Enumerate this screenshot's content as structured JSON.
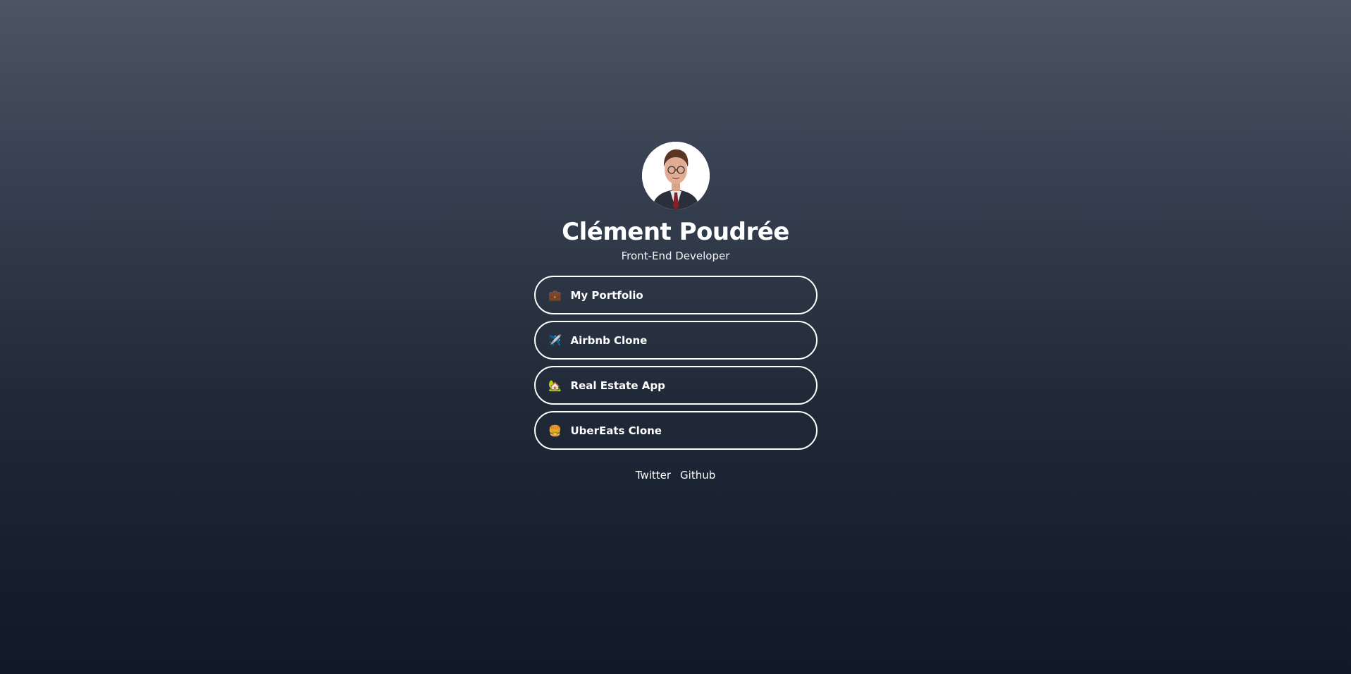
{
  "profile": {
    "name": "Clément Poudrée",
    "role": "Front-End Developer",
    "avatar_alt": "profile-photo"
  },
  "links": [
    {
      "icon": "briefcase-icon",
      "emoji": "💼",
      "label": "My Portfolio"
    },
    {
      "icon": "airplane-icon",
      "emoji": "✈️",
      "label": "Airbnb Clone"
    },
    {
      "icon": "house-icon",
      "emoji": "🏡",
      "label": "Real Estate App"
    },
    {
      "icon": "burger-icon",
      "emoji": "🍔",
      "label": "UberEats Clone"
    }
  ],
  "socials": {
    "twitter": "Twitter",
    "github": "Github"
  },
  "colors": {
    "background_top": "#4b5563",
    "background_bottom": "#111827",
    "text": "#ffffff",
    "button_border": "#ffffff"
  }
}
